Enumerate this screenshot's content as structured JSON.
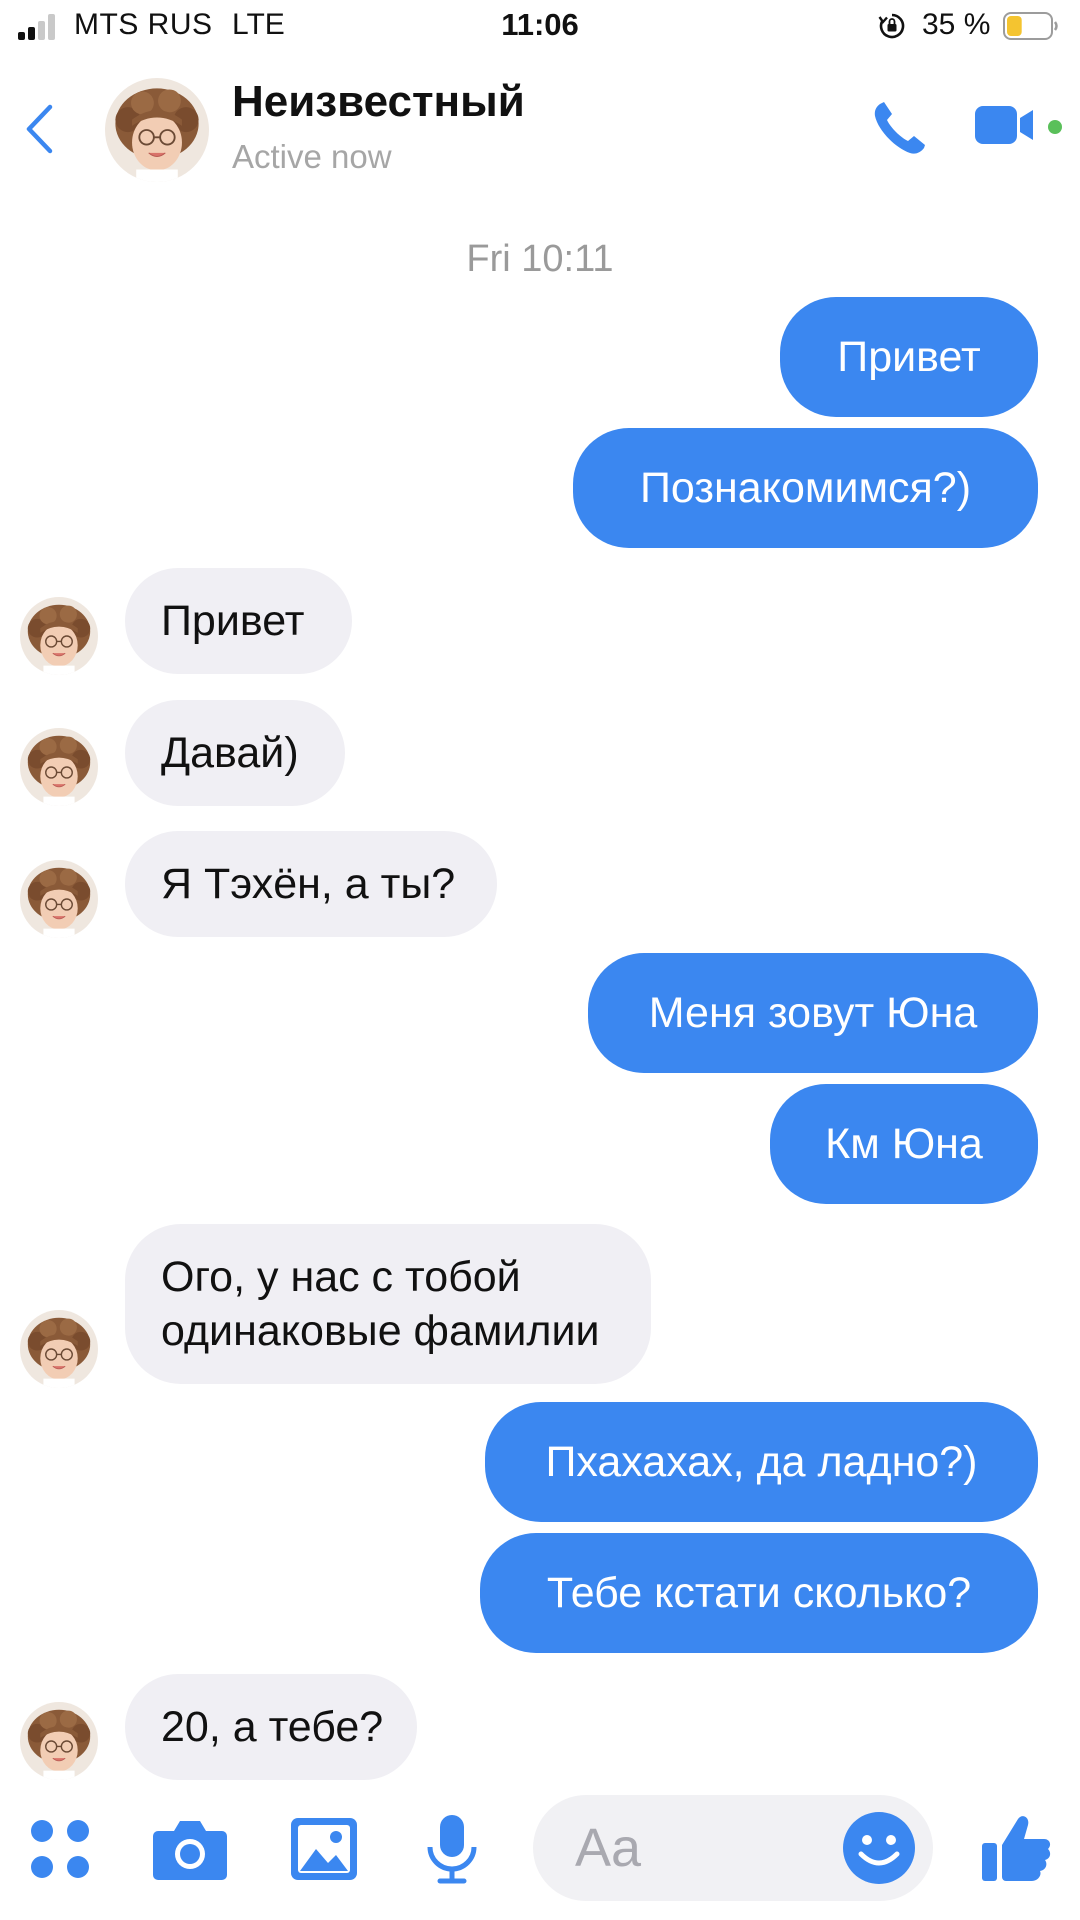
{
  "status_bar": {
    "carrier": "MTS RUS",
    "network": "LTE",
    "time": "11:06",
    "battery_percent": "35 %",
    "battery_level": 0.35
  },
  "header": {
    "contact_name": "Неизвестный",
    "status": "Active now",
    "back_icon": "chevron-left-icon",
    "call_icon": "phone-icon",
    "video_icon": "video-camera-icon"
  },
  "conversation": {
    "timestamp": "Fri 10:11",
    "messages": [
      {
        "side": "out",
        "text": "Привет"
      },
      {
        "side": "out",
        "text": "Познакомимся?)"
      },
      {
        "side": "in",
        "text": "Привет"
      },
      {
        "side": "in",
        "text": "Давай)"
      },
      {
        "side": "in",
        "text": "Я Тэхён, а ты?"
      },
      {
        "side": "out",
        "text": "Меня зовут Юна"
      },
      {
        "side": "out",
        "text": "Км Юна"
      },
      {
        "side": "in",
        "line1": "Ого, у нас с тобой",
        "line2": "одинаковые фамилии"
      },
      {
        "side": "out",
        "text": "Пхахахах, да ладно?)"
      },
      {
        "side": "out",
        "text": "Тебе кстати сколько?"
      },
      {
        "side": "in",
        "text": "20, а тебе?"
      }
    ]
  },
  "composer": {
    "placeholder": "Aa",
    "icons": [
      "apps-icon",
      "camera-icon",
      "gallery-icon",
      "microphone-icon",
      "emoji-icon",
      "thumbs-up-icon"
    ]
  },
  "colors": {
    "accent": "#3b87f0",
    "incoming_bubble": "#f0eff4",
    "online_dot": "#5ac05a",
    "battery_fill": "#f4c430"
  }
}
